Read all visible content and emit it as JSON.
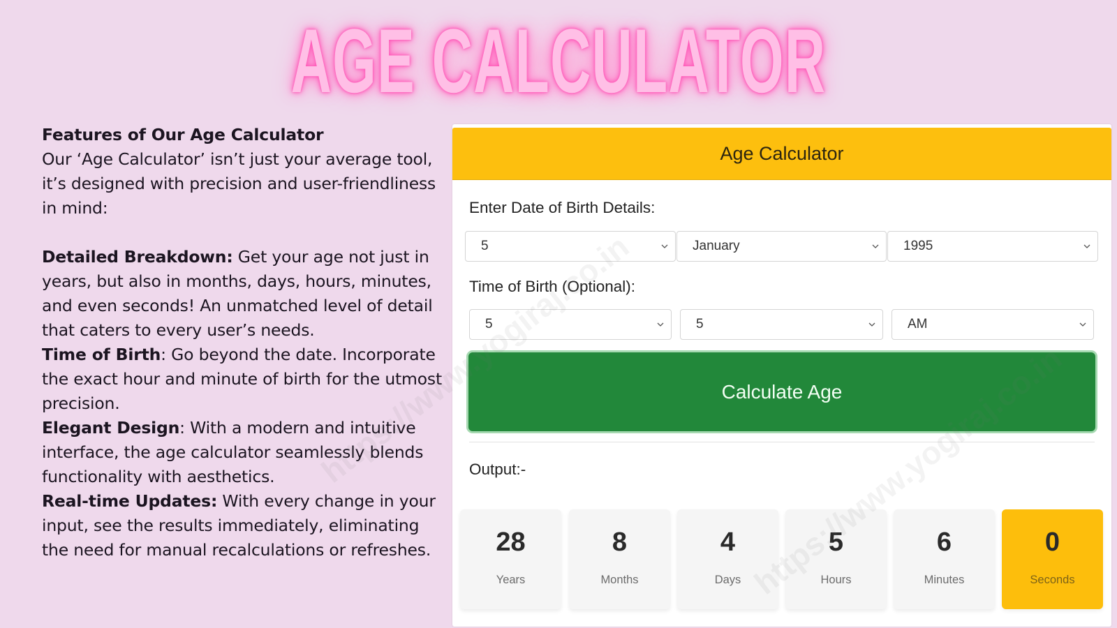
{
  "hero": {
    "title": "AGE CALCULATOR"
  },
  "features": {
    "heading": "Features of Our Age Calculator",
    "intro": "Our ‘Age Calculator’ isn’t just your average tool, it’s designed with precision and user-friendliness in mind:",
    "items": [
      {
        "title": "Detailed Breakdown:",
        "text": " Get your age not just in years, but also in months, days, hours, minutes, and even seconds! An unmatched level of detail that caters to every user’s needs."
      },
      {
        "title": "Time of Birth",
        "text": ": Go beyond the date. Incorporate the exact hour and minute of birth for the utmost precision."
      },
      {
        "title": "Elegant Design",
        "text": ": With a modern and intuitive interface, the age calculator seamlessly blends functionality with aesthetics."
      },
      {
        "title": "Real-time Updates:",
        "text": " With every change in your input, see the results immediately, eliminating the need for manual recalculations or refreshes."
      }
    ]
  },
  "calculator": {
    "header": "Age Calculator",
    "dob_label": "Enter Date of Birth Details:",
    "dob": {
      "day": "5",
      "month": "January",
      "year": "1995"
    },
    "tob_label": "Time of Birth (Optional):",
    "tob": {
      "hour": "5",
      "minute": "5",
      "period": "AM"
    },
    "button_label": "Calculate Age",
    "output_label": "Output:-",
    "results": [
      {
        "value": "28",
        "unit": "Years"
      },
      {
        "value": "8",
        "unit": "Months"
      },
      {
        "value": "4",
        "unit": "Days"
      },
      {
        "value": "5",
        "unit": "Hours"
      },
      {
        "value": "6",
        "unit": "Minutes"
      },
      {
        "value": "0",
        "unit": "Seconds"
      }
    ],
    "highlight_color": "#fdbe0c",
    "button_color": "#22883a",
    "header_color": "#fdbf0e"
  },
  "watermark": {
    "text": "https://www.yogiraj.co.in"
  }
}
